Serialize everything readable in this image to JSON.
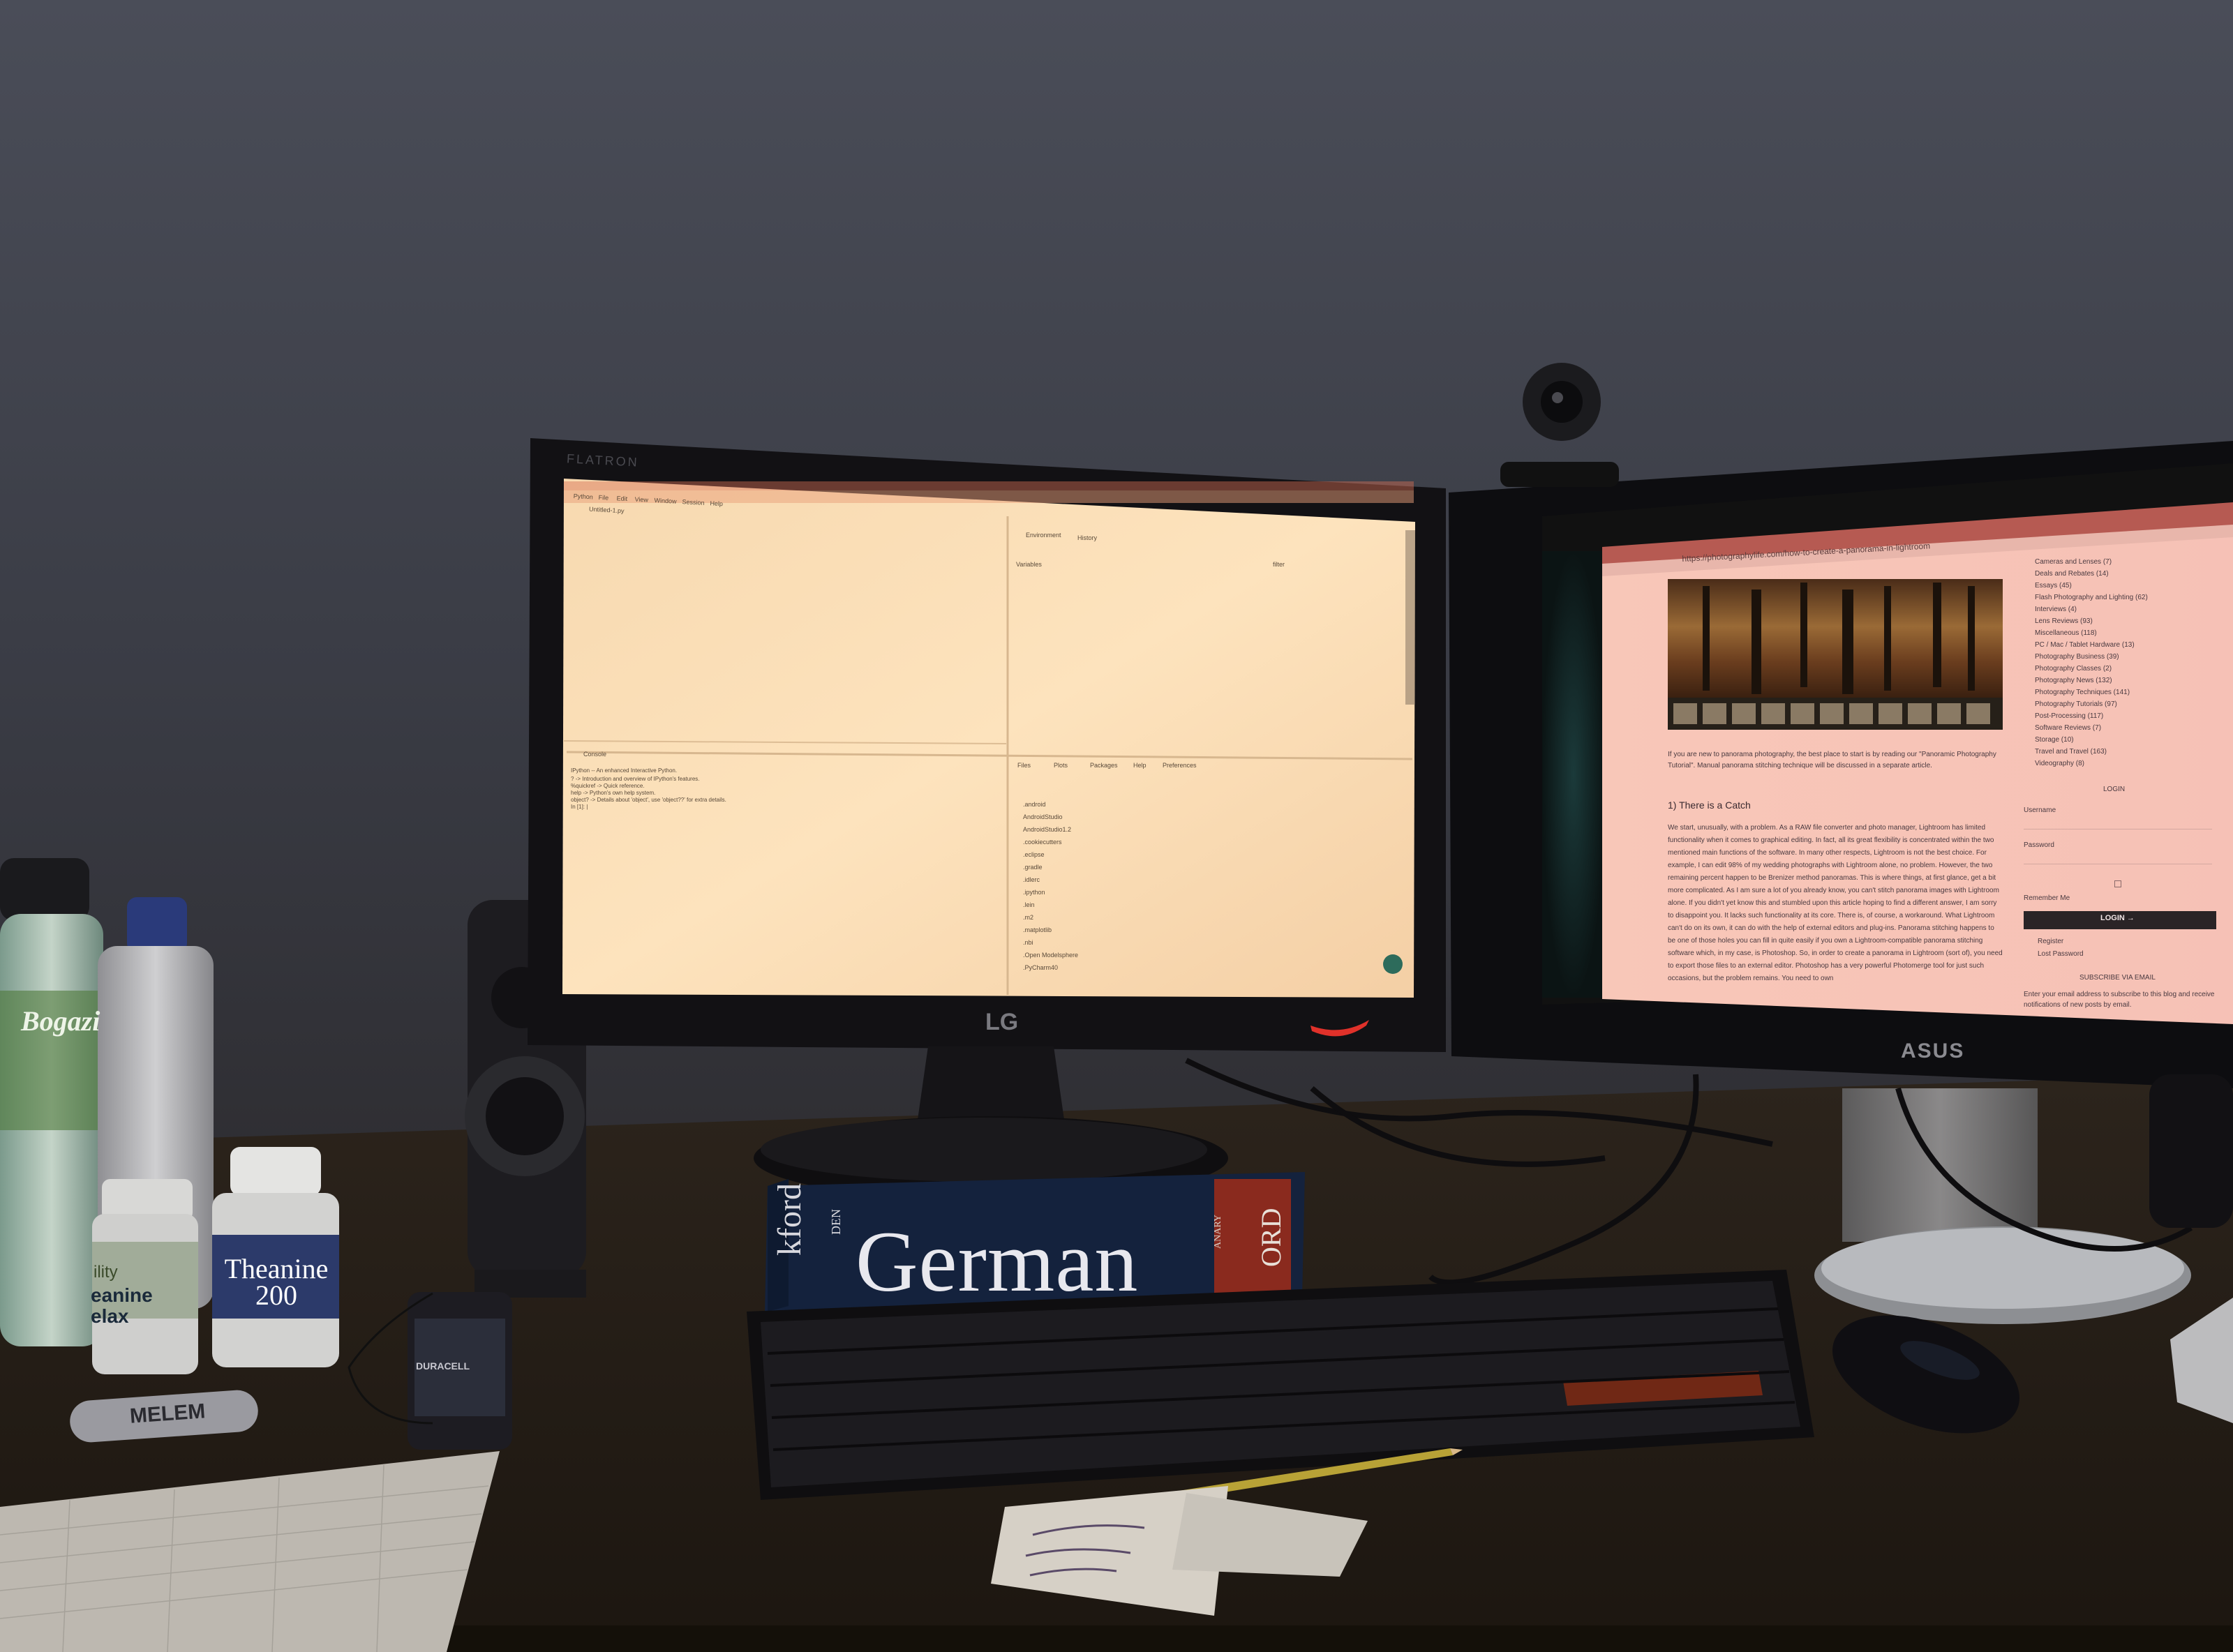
{
  "left_monitor": {
    "bezel_brand": "FLATRON",
    "logo": "LG",
    "ide": {
      "menu": [
        "Python",
        "File",
        "Edit",
        "View",
        "Window",
        "Session",
        "Help"
      ],
      "editor_tab": "Untitled-1.py",
      "env_tabs": [
        "Environment",
        "History"
      ],
      "env_label": "Variables",
      "env_search": "filter",
      "console_tab": "Console",
      "console_lines": [
        "IPython -- An enhanced Interactive Python.",
        "?         -> Introduction and overview of IPython's features.",
        "%quickref -> Quick reference.",
        "help      -> Python's own help system.",
        "object?   -> Details about 'object', use 'object??' for extra details.",
        "In [1]: |"
      ],
      "files_tabs": [
        "Files",
        "Plots",
        "Packages",
        "Help",
        "Preferences"
      ],
      "files": [
        ".android",
        "AndroidStudio",
        "AndroidStudio1.2",
        ".cookiecutters",
        ".eclipse",
        ".gradle",
        ".idlerc",
        ".ipython",
        ".lein",
        ".m2",
        ".matplotlib",
        ".nbi",
        ".Open Modelsphere",
        ".PyCharm40"
      ]
    }
  },
  "right_monitor": {
    "logo": "ASUS",
    "browser": {
      "url": "https://photographylife.com/how-to-create-a-panorama-in-lightroom",
      "intro": "If you are new to panorama photography, the best place to start is by reading our \"Panoramic Photography Tutorial\". Manual panorama stitching technique will be discussed in a separate article.",
      "heading": "1) There is a Catch",
      "paragraph": "We start, unusually, with a problem. As a RAW file converter and photo manager, Lightroom has limited functionality when it comes to graphical editing. In fact, all its great flexibility is concentrated within the two mentioned main functions of the software. In many other respects, Lightroom is not the best choice. For example, I can edit 98% of my wedding photographs with Lightroom alone, no problem. However, the two remaining percent happen to be Brenizer method panoramas. This is where things, at first glance, get a bit more complicated. As I am sure a lot of you already know, you can't stitch panorama images with Lightroom alone. If you didn't yet know this and stumbled upon this article hoping to find a different answer, I am sorry to disappoint you. It lacks such functionality at its core. There is, of course, a workaround. What Lightroom can't do on its own, it can do with the help of external editors and plug-ins. Panorama stitching happens to be one of those holes you can fill in quite easily if you own a Lightroom-compatible panorama stitching software which, in my case, is Photoshop. So, in order to create a panorama in Lightroom (sort of), you need to export those files to an external editor. Photoshop has a very powerful Photomerge tool for just such occasions, but the problem remains. You need to own",
      "sidebar_categories": [
        "Cameras and Lenses (7)",
        "Deals and Rebates (14)",
        "Essays (45)",
        "Flash Photography and Lighting (62)",
        "Interviews (4)",
        "Lens Reviews (93)",
        "Miscellaneous (118)",
        "PC / Mac / Tablet Hardware (13)",
        "Photography Business (39)",
        "Photography Classes (2)",
        "Photography News (132)",
        "Photography Techniques (141)",
        "Photography Tutorials (97)",
        "Post-Processing (117)",
        "Software Reviews (7)",
        "Storage (10)",
        "Travel and Travel (163)",
        "Videography (8)"
      ],
      "login_title": "LOGIN",
      "username_label": "Username",
      "password_label": "Password",
      "remember_label": "Remember Me",
      "login_button": "LOGIN →",
      "register_link": "Register",
      "lost_password_link": "Lost Password",
      "subscribe_title": "SUBSCRIBE VIA EMAIL",
      "subscribe_text": "Enter your email address to subscribe to this blog and receive notifications of new posts by email."
    }
  },
  "desk_items": {
    "book_spine": "German",
    "book_side_left": "kford",
    "book_side_sub": "DEN",
    "book_side_right": "ORD",
    "book_side_small": "ANARY",
    "bottle_left_label": "Bogazi",
    "supplement_small": "eanine\nelax",
    "supplement_small_top": "ility",
    "supplement_big": "Theanine\n200",
    "inhaler_label": "MELEM",
    "battery_label": "DURACELL"
  }
}
